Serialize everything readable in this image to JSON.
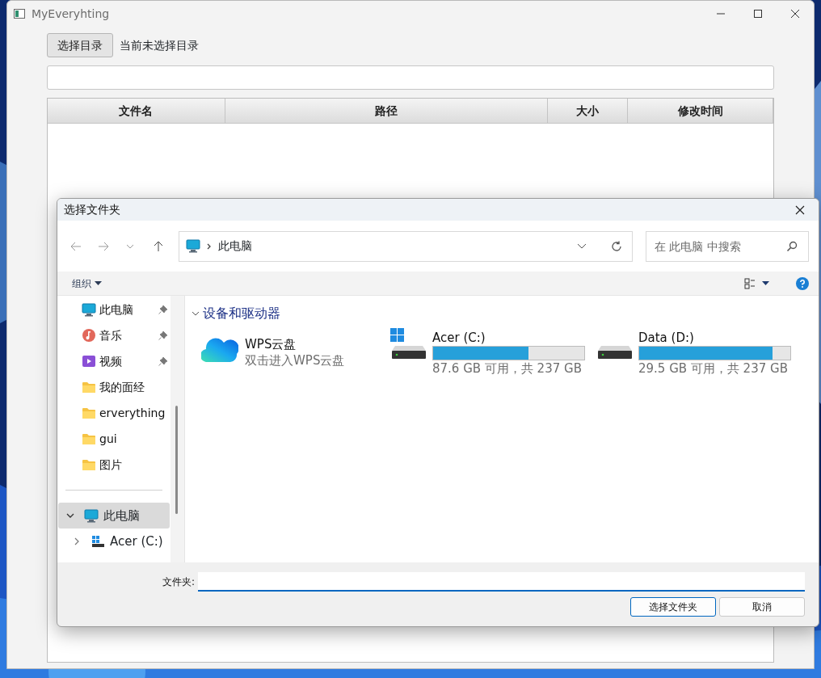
{
  "main_window": {
    "title": "MyEveryhting",
    "choose_button": "选择目录",
    "status_text": "当前未选择目录",
    "table": {
      "columns": [
        "文件名",
        "路径",
        "大小",
        "修改时间"
      ]
    }
  },
  "dialog": {
    "title": "选择文件夹",
    "address": {
      "items": [
        "此电脑"
      ]
    },
    "search": {
      "placeholder": "在 此电脑 中搜索"
    },
    "organize_menu": "组织",
    "nav_pane": {
      "quick_access": [
        {
          "label": "此电脑",
          "kind": "monitor",
          "pinned": true
        },
        {
          "label": "音乐",
          "kind": "music",
          "pinned": true
        },
        {
          "label": "视频",
          "kind": "video",
          "pinned": true
        },
        {
          "label": "我的面经",
          "kind": "folder",
          "pinned": false
        },
        {
          "label": "erverything",
          "kind": "folder",
          "pinned": false
        },
        {
          "label": "gui",
          "kind": "folder",
          "pinned": false
        },
        {
          "label": "图片",
          "kind": "folder",
          "pinned": false
        }
      ],
      "tree": [
        {
          "label": "此电脑",
          "kind": "monitor",
          "expanded": true,
          "selected": true,
          "children": [
            {
              "label": "Acer (C:)",
              "kind": "drive",
              "expanded": false,
              "selected": false
            }
          ]
        }
      ]
    },
    "section": {
      "title": "设备和驱动器",
      "expanded": true
    },
    "items": [
      {
        "kind": "cloud",
        "name": "WPS云盘",
        "subtitle": "双击进入WPS云盘"
      },
      {
        "kind": "drive",
        "name": "Acer (C:)",
        "system": true,
        "level": 0.63,
        "reading": "87.6 GB 可用，共 237 GB"
      },
      {
        "kind": "drive",
        "name": "Data (D:)",
        "system": false,
        "level": 0.88,
        "reading": "29.5 GB 可用，共 237 GB"
      }
    ],
    "folder_label": "文件夹:",
    "buttons": [
      {
        "label": "选择文件夹",
        "kind": "primary"
      },
      {
        "label": "取消",
        "kind": "secondary"
      }
    ]
  }
}
